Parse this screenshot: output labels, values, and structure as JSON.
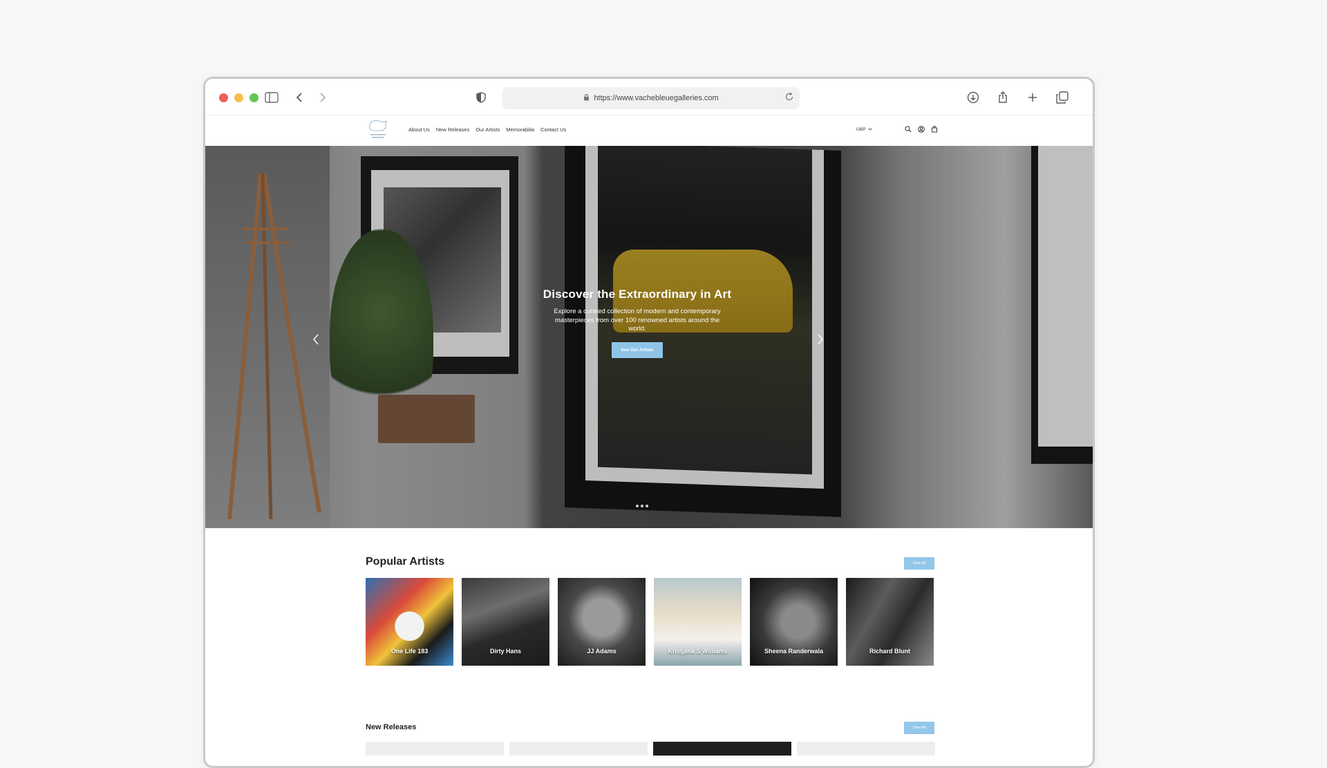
{
  "browser": {
    "url": "https://www.vachebleuegalleries.com"
  },
  "header": {
    "nav": [
      "About Us",
      "New Releases",
      "Our Artists",
      "Memorabilia",
      "Contact Us"
    ],
    "currency": "GBP"
  },
  "hero": {
    "title": "Discover the Extraordinary in Art",
    "subtitle": "Explore a curated collection of modern and contemporary masterpieces from over 100 renowned artists around the world.",
    "button": "See Our Artists",
    "slide_count": 3
  },
  "popular": {
    "title": "Popular Artists",
    "view_all": "View All",
    "artists": [
      "One Life 183",
      "Dirty Hans",
      "JJ Adams",
      "Kristjana S Williams",
      "Sheena Randerwala",
      "Richard Blunt"
    ]
  },
  "releases": {
    "title": "New Releases",
    "view_all": "View All"
  },
  "colors": {
    "accent": "#8fc4e8"
  }
}
